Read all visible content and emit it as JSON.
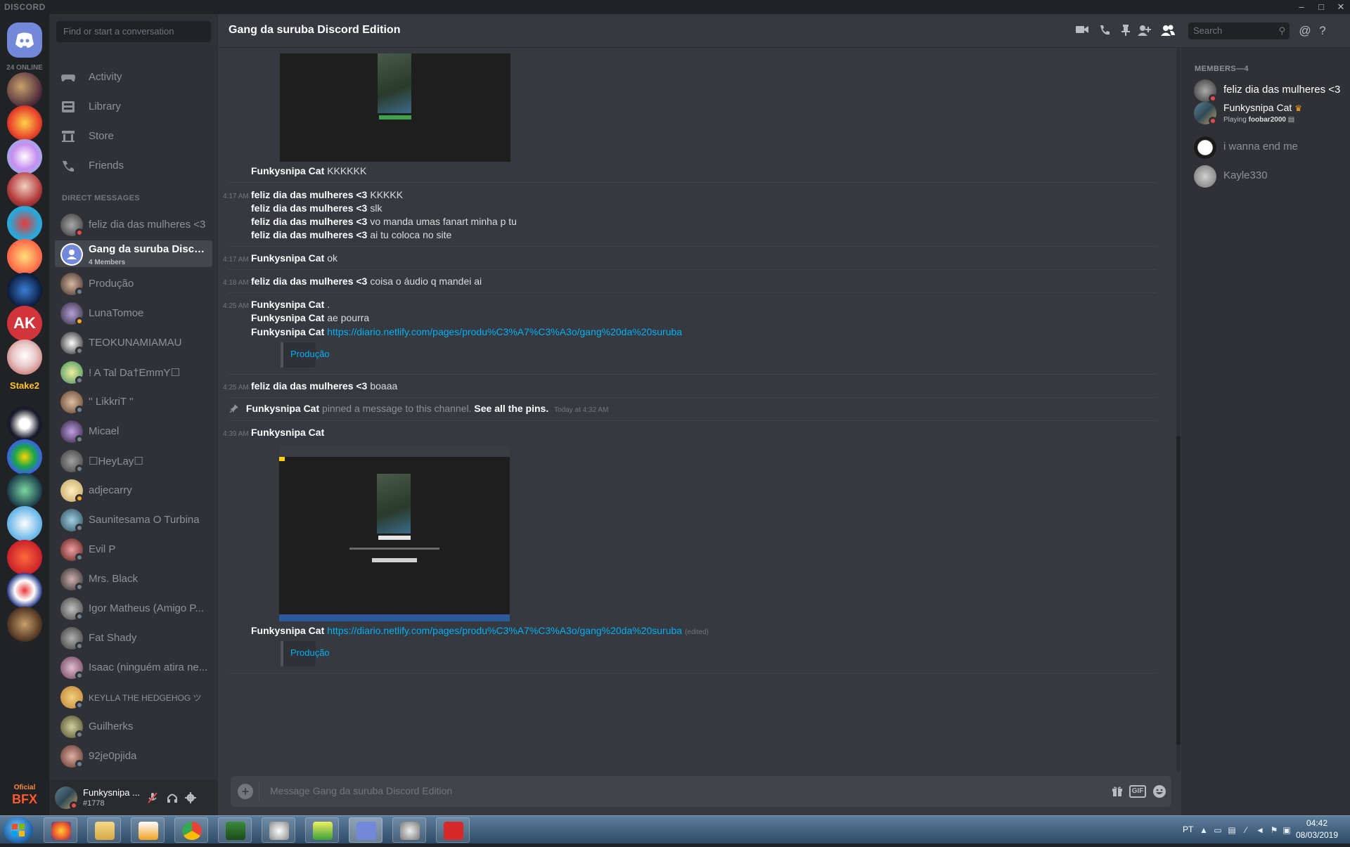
{
  "window": {
    "brand": "DISCORD",
    "min": "–",
    "max": "□",
    "close": "✕"
  },
  "servers": {
    "online": "24 ONLINE",
    "stake_label": "Stake2",
    "bfx_top": "Oficial",
    "bfx_bottom": "BFX"
  },
  "sidebar": {
    "search_placeholder": "Find or start a conversation",
    "nav": [
      {
        "label": "Activity",
        "icon": "controller-icon"
      },
      {
        "label": "Library",
        "icon": "library-icon"
      },
      {
        "label": "Store",
        "icon": "store-icon"
      },
      {
        "label": "Friends",
        "icon": "friends-icon"
      }
    ],
    "dm_header": "DIRECT MESSAGES",
    "dms": [
      {
        "name": "feliz dia das mulheres <3",
        "status": "dnd"
      },
      {
        "name": "Gang da suruba Discor...",
        "sub": "4 Members",
        "active": true
      },
      {
        "name": "Produção",
        "status": "offline"
      },
      {
        "name": "LunaTomoe",
        "status": "idle"
      },
      {
        "name": "TEOKUNAMIAMAU",
        "status": "offline"
      },
      {
        "name": "! A Tal Da†EmmY☐",
        "status": "offline"
      },
      {
        "name": "'' LikkriT ''",
        "status": "offline"
      },
      {
        "name": "Micael",
        "status": "offline"
      },
      {
        "name": "☐HeyLay☐",
        "status": "offline"
      },
      {
        "name": "adjecarry",
        "status": "idle"
      },
      {
        "name": "Saunitesama O Turbina",
        "status": "offline"
      },
      {
        "name": "Evil P",
        "status": "offline"
      },
      {
        "name": "Mrs. Black",
        "status": "offline"
      },
      {
        "name": "Igor Matheus (Amigo P...",
        "status": "offline"
      },
      {
        "name": "Fat Shady",
        "status": "offline"
      },
      {
        "name": "Isaac (ninguém atira ne...",
        "status": "offline"
      },
      {
        "name": "KEYLLA THE HEDGEHOG ツ",
        "status": "offline"
      },
      {
        "name": "Guilherks",
        "status": "offline"
      },
      {
        "name": "92je0pjida",
        "status": "offline"
      }
    ],
    "user": {
      "name": "Funkysnipa ...",
      "tag": "#1778"
    }
  },
  "header": {
    "title": "Gang da suruba Discord Edition",
    "search_placeholder": "Search"
  },
  "chat": {
    "messages": [
      {
        "ts": "",
        "author": "Funkysnipa Cat",
        "text": "KKKKKK"
      },
      {
        "ts": "4:17 AM",
        "author": "feliz dia das mulheres <3",
        "text": "KKKKK"
      },
      {
        "ts": "",
        "author": "feliz dia das mulheres <3",
        "text": "slk"
      },
      {
        "ts": "",
        "author": "feliz dia das mulheres <3",
        "text": "vo manda umas fanart minha p tu"
      },
      {
        "ts": "",
        "author": "feliz dia das mulheres <3",
        "text": "ai tu coloca no site"
      },
      {
        "ts": "4:17 AM",
        "author": "Funkysnipa Cat",
        "text": "ok"
      },
      {
        "ts": "4:18 AM",
        "author": "feliz dia das mulheres <3",
        "text": "coisa o áudio q mandei ai"
      },
      {
        "ts": "4:25 AM",
        "author": "Funkysnipa Cat",
        "text": "."
      },
      {
        "ts": "",
        "author": "Funkysnipa Cat",
        "text": "ae pourra"
      },
      {
        "ts": "",
        "author": "Funkysnipa Cat",
        "link": "https://diario.netlify.com/pages/produ%C3%A7%C3%A3o/gang%20da%20suruba"
      },
      {
        "ts": "4:25 AM",
        "author": "feliz dia das mulheres <3",
        "text": "boaaa"
      },
      {
        "ts": "4:39 AM",
        "author": "Funkysnipa Cat",
        "text": ""
      },
      {
        "ts": "",
        "author": "Funkysnipa Cat",
        "link": "https://diario.netlify.com/pages/produ%C3%A7%C3%A3o/gang%20da%20suruba",
        "edited": "(edited)"
      }
    ],
    "embed_label": "Produção",
    "pin": {
      "who": "Funkysnipa Cat",
      "pinned": "pinned a message to this channel.",
      "see_all": "See all the pins.",
      "when": "Today at 4:32 AM"
    },
    "composer_placeholder": "Message Gang da suruba Discord Edition",
    "gif_label": "GIF"
  },
  "members": {
    "header": "MEMBERS—4",
    "list": [
      {
        "name": "feliz dia das mulheres <3",
        "status": "dnd"
      },
      {
        "name": "Funkysnipa Cat",
        "status": "dnd",
        "owner": true,
        "activity_prefix": "Playing",
        "activity": "foobar2000"
      },
      {
        "name": "i wanna end me",
        "status": "offline"
      },
      {
        "name": "Kayle330",
        "status": "offline"
      }
    ]
  },
  "taskbar": {
    "lang": "PT",
    "time": "04:42",
    "date": "08/03/2019"
  },
  "colors": {
    "blurple": "#7289da",
    "dnd": "#f04747",
    "idle": "#faa61a",
    "offline": "#747f8d",
    "link": "#00b0f4"
  }
}
